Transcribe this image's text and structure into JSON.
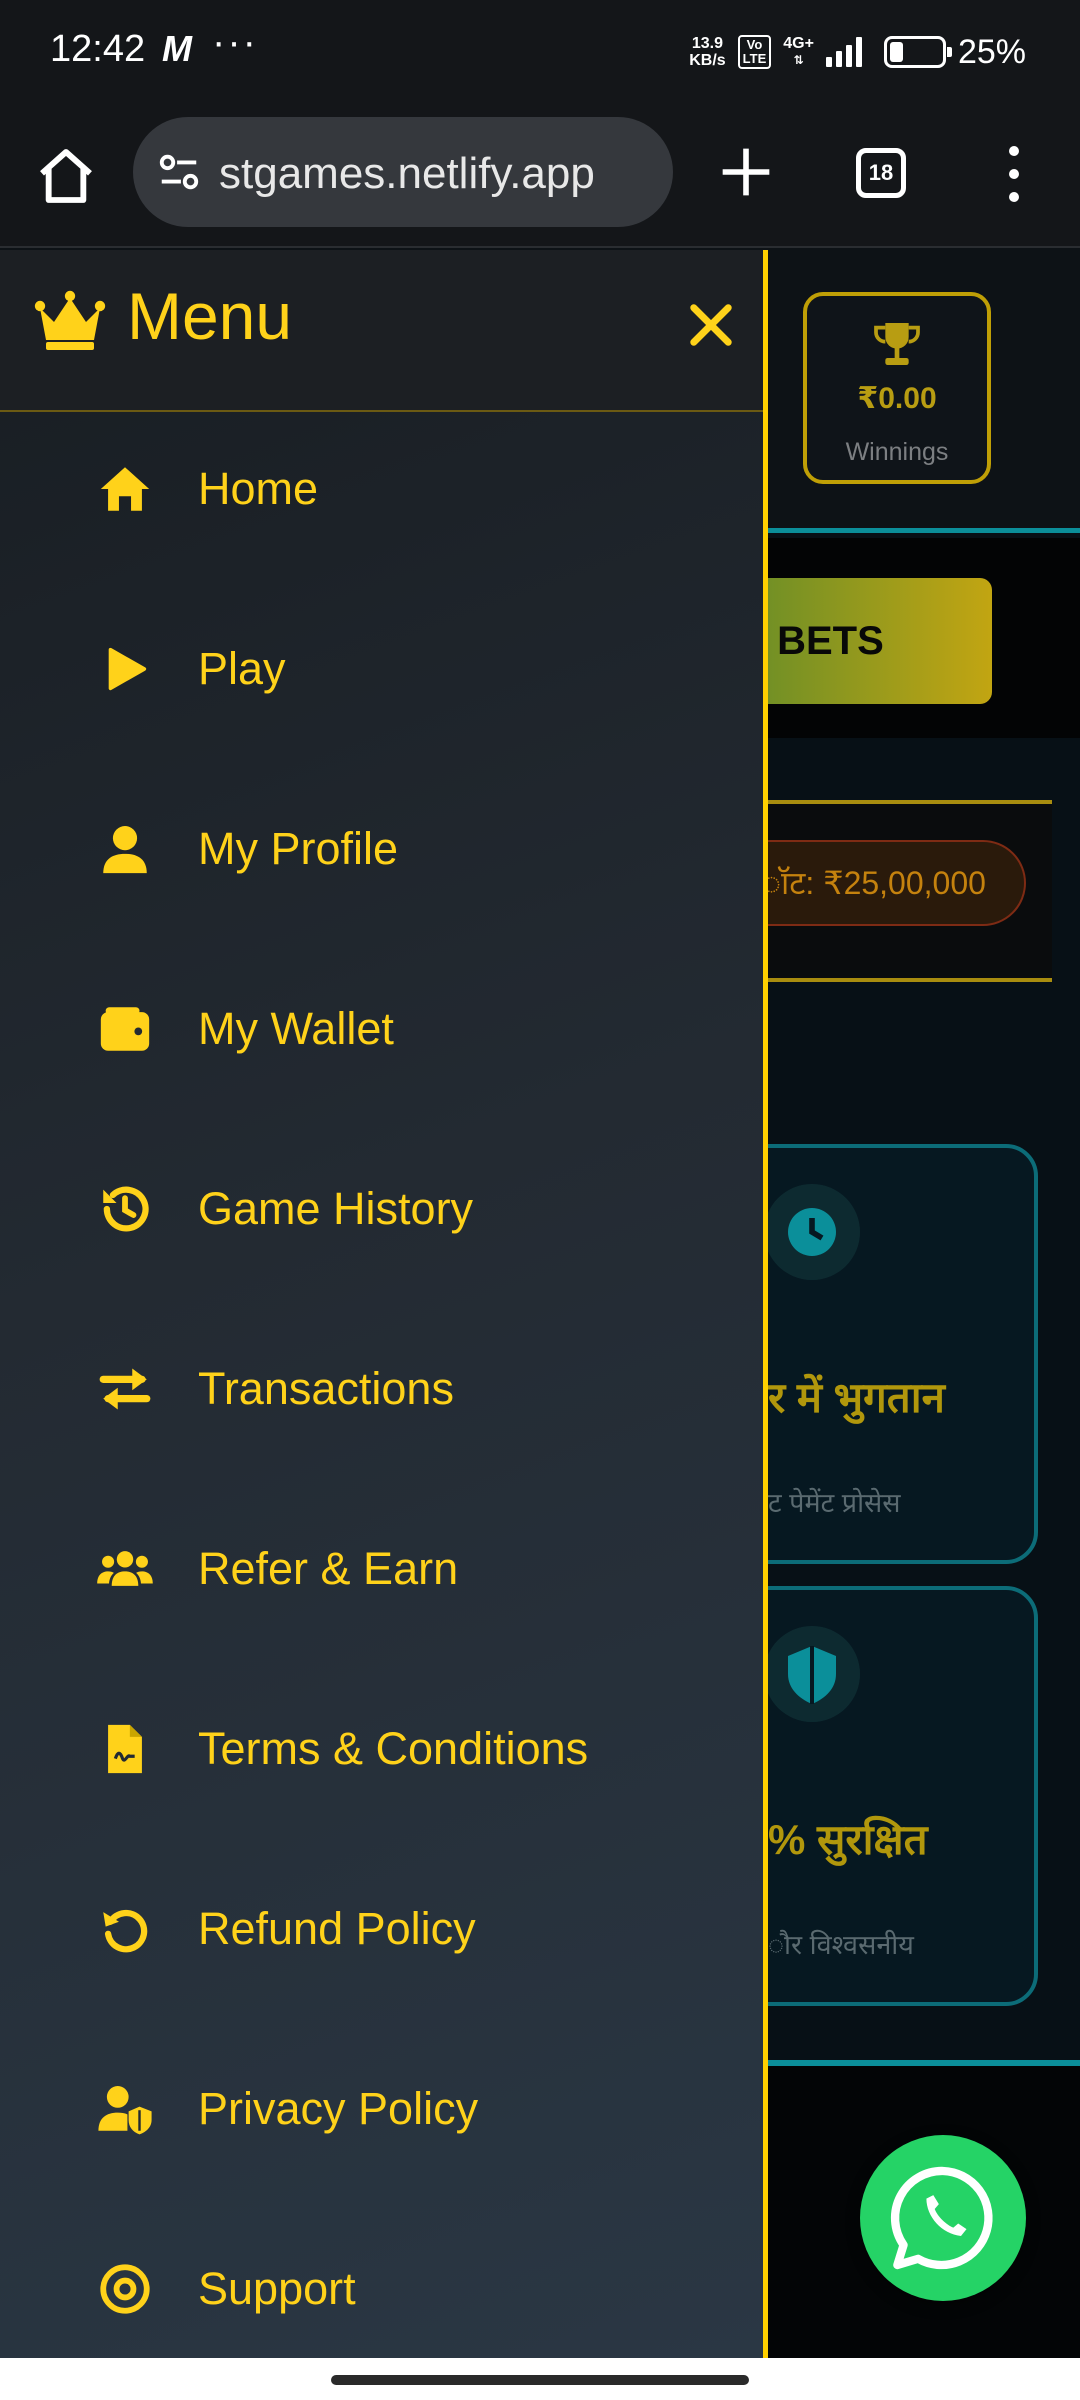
{
  "status_bar": {
    "time": "12:42",
    "carrier_glyph": "M",
    "more": "···",
    "net_speed_value": "13.9",
    "net_speed_unit": "KB/s",
    "volte_top": "Vo",
    "volte_bottom": "LTE",
    "network": "4G+",
    "battery_percent": "25%",
    "battery_level": 0.25
  },
  "browser": {
    "url": "stgames.netlify.app",
    "tab_count": "18"
  },
  "background_page": {
    "winnings_amount": "₹0.00",
    "winnings_label": "Winnings",
    "bets_button": "Y BETS",
    "jackpot_text": "ॉट: ₹25,00,000",
    "feature_1_title": "र में भुगतान",
    "feature_1_subtitle": "ट पेमेंट प्रोसेस",
    "feature_2_title": "% सुरक्षित",
    "feature_2_subtitle": "ौर विश्वसनीय"
  },
  "menu": {
    "title": "Menu",
    "items": [
      {
        "label": "Home",
        "icon": "home-icon"
      },
      {
        "label": "Play",
        "icon": "play-icon"
      },
      {
        "label": "My Profile",
        "icon": "user-icon"
      },
      {
        "label": "My Wallet",
        "icon": "wallet-icon"
      },
      {
        "label": "Game History",
        "icon": "history-icon"
      },
      {
        "label": "Transactions",
        "icon": "transfer-icon"
      },
      {
        "label": "Refer & Earn",
        "icon": "users-icon"
      },
      {
        "label": "Terms & Conditions",
        "icon": "document-icon"
      },
      {
        "label": "Refund Policy",
        "icon": "refund-icon"
      },
      {
        "label": "Privacy Policy",
        "icon": "user-shield-icon"
      },
      {
        "label": "Support",
        "icon": "support-icon"
      }
    ]
  },
  "colors": {
    "accent": "#ffd21a",
    "menu_border": "#ffd000",
    "teal": "#0b8f9a",
    "whatsapp": "#25d366"
  }
}
